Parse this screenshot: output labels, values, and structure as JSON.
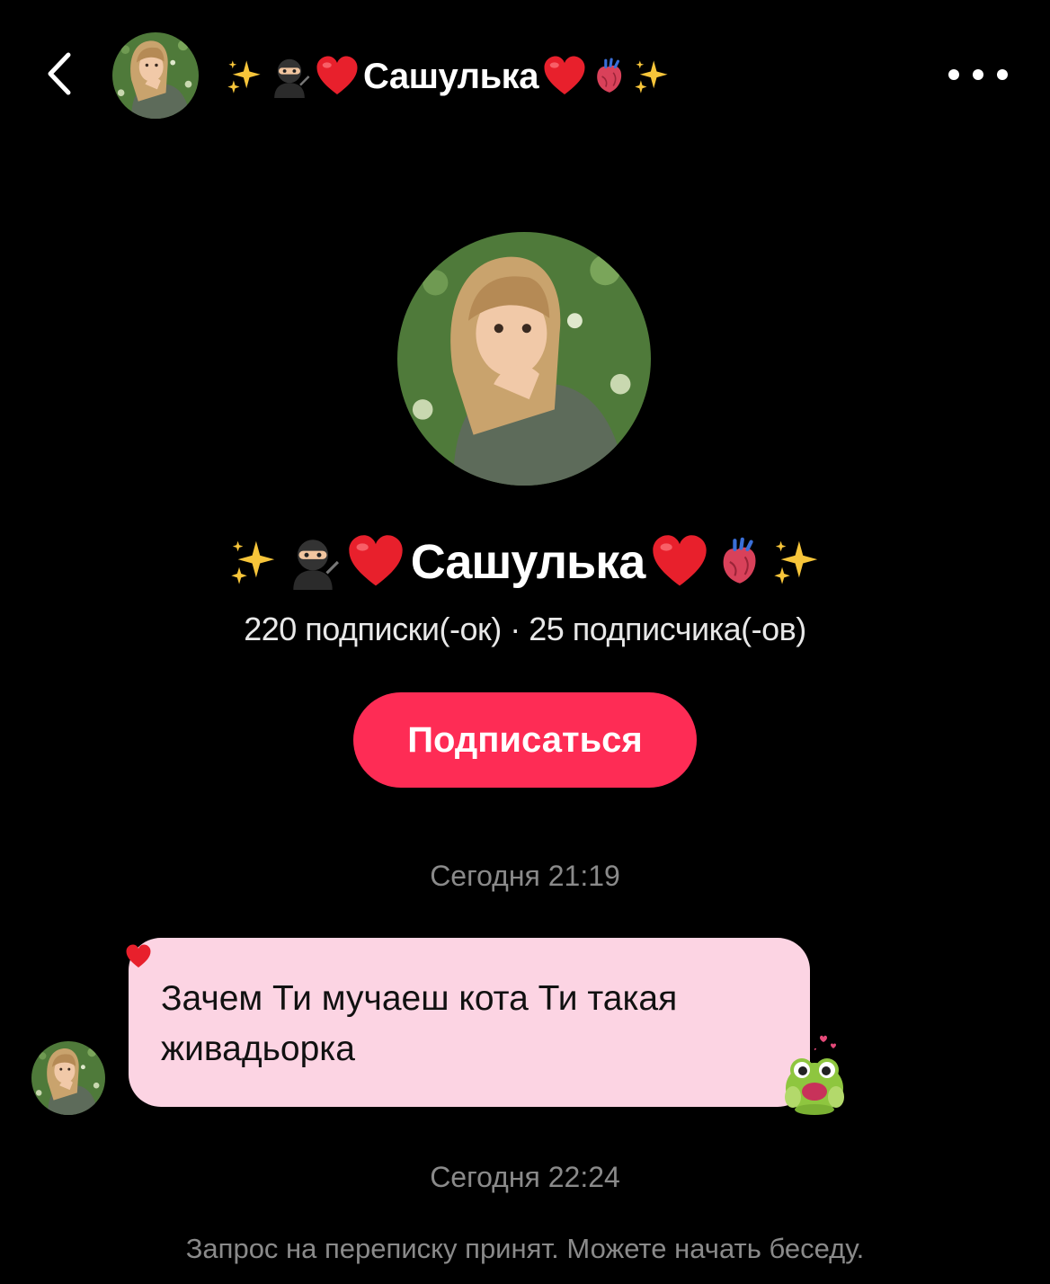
{
  "header": {
    "back_label": "back",
    "title": "Сашулька",
    "title_prefix_emoji": [
      "sparkles",
      "ninja",
      "red-heart"
    ],
    "title_suffix_emoji": [
      "red-heart",
      "anatomical-heart",
      "sparkles"
    ]
  },
  "profile": {
    "name": "Сашулька",
    "stats": "220 подписки(-ок) · 25 подписчика(-ов)",
    "follow_label": "Подписаться"
  },
  "messages": {
    "timestamp_1": "Сегодня 21:19",
    "text": "Зачем Ти мучаеш кота Ти такая живадьорка",
    "timestamp_2": "Сегодня 22:24",
    "system_note": "Запрос на переписку принят. Можете начать беседу."
  },
  "colors": {
    "background": "#000000",
    "accent": "#fe2c55",
    "bubble": "#fcd4e3",
    "muted_text": "#8a8a8a"
  }
}
